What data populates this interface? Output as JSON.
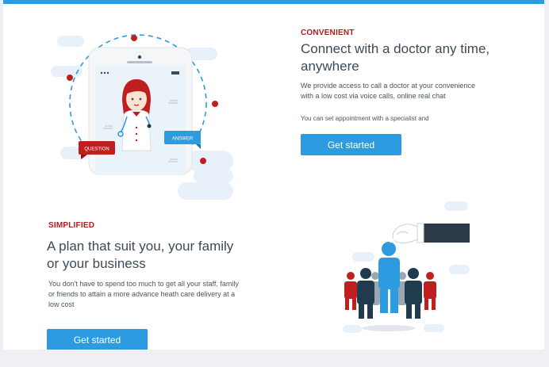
{
  "section1": {
    "eyebrow": "CONVENIENT",
    "heading_line1": "Connect with a doctor any time,",
    "heading_line2": "anywhere",
    "body_line1": "We provide access to call a doctor at your convenience",
    "body_line2": "with a low cost via voice calls, online real chat",
    "body2": "You can set appointment with a specialist and",
    "button": "Get started",
    "illustration": {
      "question_label": "QUESTION",
      "answer_label": "ANSWER"
    }
  },
  "section2": {
    "eyebrow": "SIMPLIFIED",
    "heading_line1": "A plan that suit you, your family",
    "heading_line2": "or your business",
    "body_line1": "You don't have to spend too much to get all your staff, family",
    "body_line2": "or friends to attain a more advance heath care delivery at a",
    "body_line3": "low cost",
    "button": "Get started"
  },
  "colors": {
    "accent_blue": "#2d9be0",
    "eyebrow_red": "#b11b1b",
    "heading": "#3d4a57",
    "navy": "#1f3b4d"
  }
}
